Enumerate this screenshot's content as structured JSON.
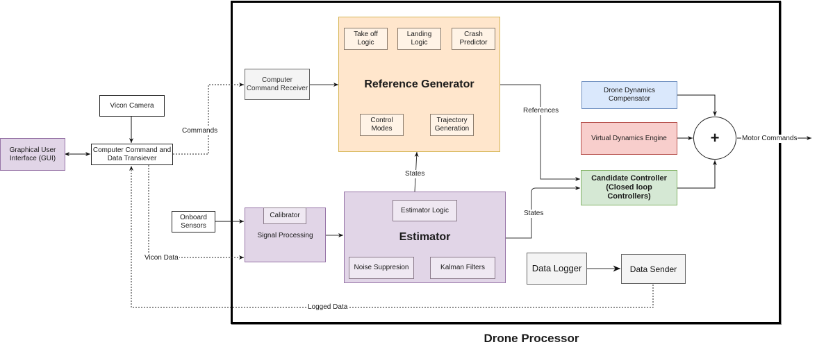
{
  "diagram": {
    "caption": "Drone Processor",
    "external": {
      "gui": "Graphical User Interface (GUI)",
      "vicon_camera": "Vicon Camera",
      "transceiver": "Computer Command and Data Transiever",
      "onboard_sensors": "Onboard Sensors"
    },
    "processor": {
      "command_receiver": "Computer Command Receiver",
      "reference_generator": {
        "title": "Reference Generator",
        "modules": [
          "Take off Logic",
          "Landing Logic",
          "Crash Predictor",
          "Control Modes",
          "Trajectory Generation"
        ]
      },
      "signal_processing": {
        "title": "Signal Processing",
        "modules": [
          "Calibrator"
        ]
      },
      "estimator": {
        "title": "Estimator",
        "modules": [
          "Estimator Logic",
          "Noise Suppresion",
          "Kalman Filters"
        ]
      },
      "drone_dynamics_compensator": "Drone Dynamics Compensator",
      "virtual_dynamics_engine": "Virtual Dynamics Engine",
      "candidate_controller": "Candidate Controller (Closed loop Controllers)",
      "summing_junction": "+",
      "data_logger": "Data Logger",
      "data_sender": "Data Sender"
    },
    "edge_labels": {
      "commands": "Commands",
      "references": "References",
      "states_up": "States",
      "states_right": "States",
      "motor_commands": "Motor Commands",
      "vicon_data": "Vicon Data",
      "logged_data": "Logged Data"
    },
    "colors": {
      "reference_generator_fill": "#ffe6cc",
      "estimator_fill": "#e1d5e7",
      "compensator_fill": "#dae8fc",
      "engine_fill": "#f8cecc",
      "controller_fill": "#d5e8d4"
    }
  }
}
